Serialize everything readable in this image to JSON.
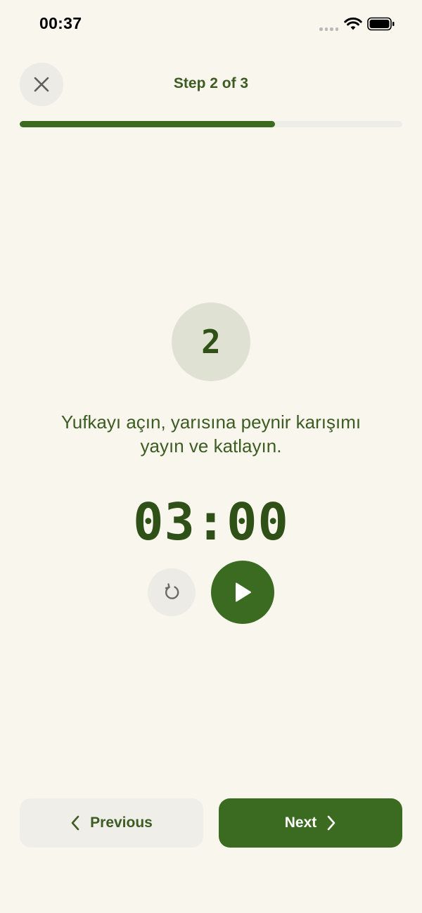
{
  "status_bar": {
    "time": "00:37"
  },
  "header": {
    "close_icon": "close-icon",
    "step_label": "Step 2 of 3",
    "progress_fraction": 0.667
  },
  "step": {
    "number": "2",
    "instruction": "Yufkayı açın, yarısına peynir karışımı yayın ve katlayın."
  },
  "timer": {
    "display": "03:00",
    "reset_icon": "reset-icon",
    "play_icon": "play-icon"
  },
  "navigation": {
    "previous_label": "Previous",
    "next_label": "Next"
  },
  "colors": {
    "background": "#f9f6ee",
    "accent": "#3b6b21",
    "text_green": "#3c5c22",
    "step_circle_bg": "#dfe2d2",
    "secondary_button": "#efeee9"
  }
}
